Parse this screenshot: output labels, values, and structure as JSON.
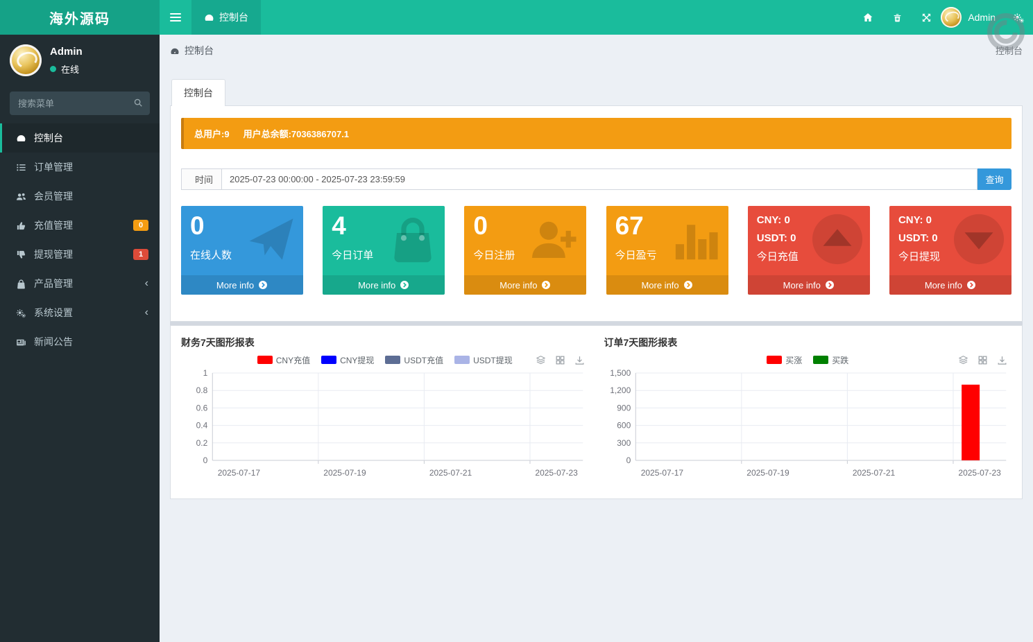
{
  "app": {
    "title": "海外源码"
  },
  "header": {
    "nav_tab": "控制台",
    "right_icons": [
      "home-icon",
      "trash-icon",
      "expand-icon"
    ],
    "user_name": "Admin",
    "colors": {
      "navbar": "#1abc9c",
      "logo_bg": "#15a287"
    }
  },
  "watermark": "copyright-circle",
  "sidebar": {
    "user": {
      "name": "Admin",
      "status": "在线",
      "status_color": "#1abc9c"
    },
    "search_placeholder": "搜索菜单",
    "items": [
      {
        "label": "控制台",
        "icon": "gauge-icon",
        "active": true
      },
      {
        "label": "订单管理",
        "icon": "list-icon"
      },
      {
        "label": "会员管理",
        "icon": "users-icon"
      },
      {
        "label": "充值管理",
        "icon": "hand-up-icon",
        "badge": "0",
        "badge_color": "#f39c12"
      },
      {
        "label": "提现管理",
        "icon": "hand-down-icon",
        "badge": "1",
        "badge_color": "#dd4b39"
      },
      {
        "label": "产品管理",
        "icon": "bag-icon",
        "chevron": true
      },
      {
        "label": "系统设置",
        "icon": "gears-icon",
        "chevron": true
      },
      {
        "label": "新闻公告",
        "icon": "newspaper-icon"
      }
    ]
  },
  "breadcrumb": {
    "left": "控制台",
    "right": "控制台"
  },
  "main": {
    "tab": "控制台",
    "banner": {
      "users": "总用户:9",
      "balance": "用户总余额:7036386707.1",
      "color": "#f39c12"
    },
    "filter": {
      "label": "时间",
      "value": "2025-07-23 00:00:00 - 2025-07-23 23:59:59",
      "button": "查询",
      "button_color": "#3498db"
    },
    "info_boxes": [
      {
        "color": "#3498db",
        "icon": "paper-plane-icon",
        "number": "0",
        "label": "在线人数",
        "more": "More info"
      },
      {
        "color": "#1abc9c",
        "icon": "shopping-bag-icon",
        "number": "4",
        "label": "今日订单",
        "more": "More info"
      },
      {
        "color": "#f39c12",
        "icon": "user-plus-icon",
        "number": "0",
        "label": "今日注册",
        "more": "More info"
      },
      {
        "color": "#f39c12",
        "icon": "bar-chart-icon",
        "number": "67",
        "label": "今日盈亏",
        "more": "More info"
      },
      {
        "color": "#e74c3c",
        "icon": "caret-up-circle-icon",
        "lines": [
          "CNY:  0",
          "USDT:  0",
          "今日充值"
        ],
        "more": "More info"
      },
      {
        "color": "#e74c3c",
        "icon": "caret-down-circle-icon",
        "lines": [
          "CNY:  0",
          "USDT:  0",
          "今日提现"
        ],
        "more": "More info"
      }
    ]
  },
  "chart_data": [
    {
      "type": "bar",
      "title": "财务7天图形报表",
      "categories": [
        "2025-07-17",
        "2025-07-18",
        "2025-07-19",
        "2025-07-20",
        "2025-07-21",
        "2025-07-22",
        "2025-07-23"
      ],
      "series": [
        {
          "name": "CNY充值",
          "color": "#ff0000",
          "values": [
            0,
            0,
            0,
            0,
            0,
            0,
            0
          ]
        },
        {
          "name": "CNY提现",
          "color": "#0000ff",
          "values": [
            0,
            0,
            0,
            0,
            0,
            0,
            0
          ]
        },
        {
          "name": "USDT充值",
          "color": "#5d6d94",
          "values": [
            0,
            0,
            0,
            0,
            0,
            0,
            0
          ]
        },
        {
          "name": "USDT提现",
          "color": "#aab4e6",
          "values": [
            0,
            0,
            0,
            0,
            0,
            0,
            0
          ]
        }
      ],
      "ylim": [
        0,
        1
      ],
      "ytick_labels": [
        "1",
        "0.8",
        "0.6",
        "0.4",
        "0.2",
        "0"
      ],
      "x_label_indices": [
        0,
        2,
        4,
        6
      ],
      "grid": true,
      "legend_position": "top",
      "toolbox": [
        "stack-icon",
        "tiled-icon",
        "download-icon"
      ]
    },
    {
      "type": "bar",
      "title": "订单7天图形报表",
      "categories": [
        "2025-07-17",
        "2025-07-18",
        "2025-07-19",
        "2025-07-20",
        "2025-07-21",
        "2025-07-22",
        "2025-07-23"
      ],
      "series": [
        {
          "name": "买涨",
          "color": "#ff0000",
          "values": [
            0,
            0,
            0,
            0,
            0,
            0,
            1300
          ]
        },
        {
          "name": "买跌",
          "color": "#008000",
          "values": [
            0,
            0,
            0,
            0,
            0,
            0,
            0
          ]
        }
      ],
      "ylim": [
        0,
        1500
      ],
      "ytick_labels": [
        "1,500",
        "1,200",
        "900",
        "600",
        "300",
        "0"
      ],
      "x_label_indices": [
        0,
        2,
        4,
        6
      ],
      "grid": true,
      "legend_position": "top",
      "toolbox": [
        "stack-icon",
        "tiled-icon",
        "download-icon"
      ]
    }
  ]
}
